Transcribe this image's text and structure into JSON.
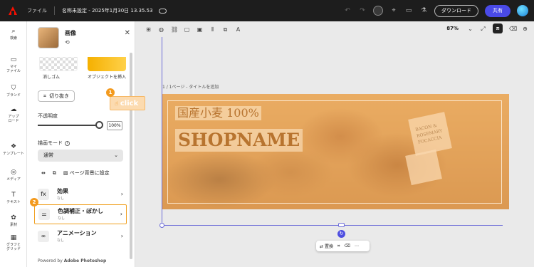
{
  "app": {
    "file_menu": "ファイル",
    "doc_title": "名称未設定 - 2025年1月30日 13.35.53",
    "download_label": "ダウンロード",
    "share_label": "共有"
  },
  "rail": [
    {
      "label": "検索",
      "icon": "search-icon"
    },
    {
      "label": "マイ\nファイル",
      "icon": "folder-icon"
    },
    {
      "label": "ブランド",
      "icon": "brand-icon"
    },
    {
      "label": "アップ\nロード",
      "icon": "upload-icon"
    },
    {
      "label": "テンプレート",
      "icon": "template-icon"
    },
    {
      "label": "メディア",
      "icon": "media-icon"
    },
    {
      "label": "テキスト",
      "icon": "text-icon"
    },
    {
      "label": "素材",
      "icon": "elements-icon"
    },
    {
      "label": "グラフと\nグリッド",
      "icon": "grid-icon"
    }
  ],
  "panel": {
    "title": "画像",
    "eraser_label": "消しゴム",
    "insert_object_label": "オブジェクトを挿入",
    "crop_label": "切り抜き",
    "opacity_label": "不透明度",
    "opacity_value": "100%",
    "opacity_level": 1.0,
    "blend_mode_label": "描画モード",
    "blend_mode_value": "通常",
    "set_background_label": "ページ背景に設定",
    "sections": [
      {
        "title": "効果",
        "sub": "なし",
        "icon": "effects-icon"
      },
      {
        "title": "色調補正・ぼかし",
        "sub": "なし",
        "icon": "adjust-icon"
      },
      {
        "title": "アニメーション",
        "sub": "なし",
        "icon": "animation-icon"
      }
    ],
    "powered_prefix": "Powered by ",
    "powered_brand": "Adobe Photoshop"
  },
  "canvas": {
    "zoom": "87%",
    "page_label": "1 / 1ページ - タイトルを追加",
    "tagline": "国産小麦 100%",
    "shopname": "SHOPNAME",
    "sign_text": "BACON &\nROSEMARY\nFOCACCIA",
    "float_replace": "置換"
  },
  "callouts": {
    "badge1": "1",
    "badge2": "2",
    "click": "click",
    "highlight_color": "#f39a1e"
  },
  "colors": {
    "topbar": "#1d1d1d",
    "share": "#4a4ae8",
    "selection": "#6d6dd8",
    "banner_text": "#b8742f"
  }
}
